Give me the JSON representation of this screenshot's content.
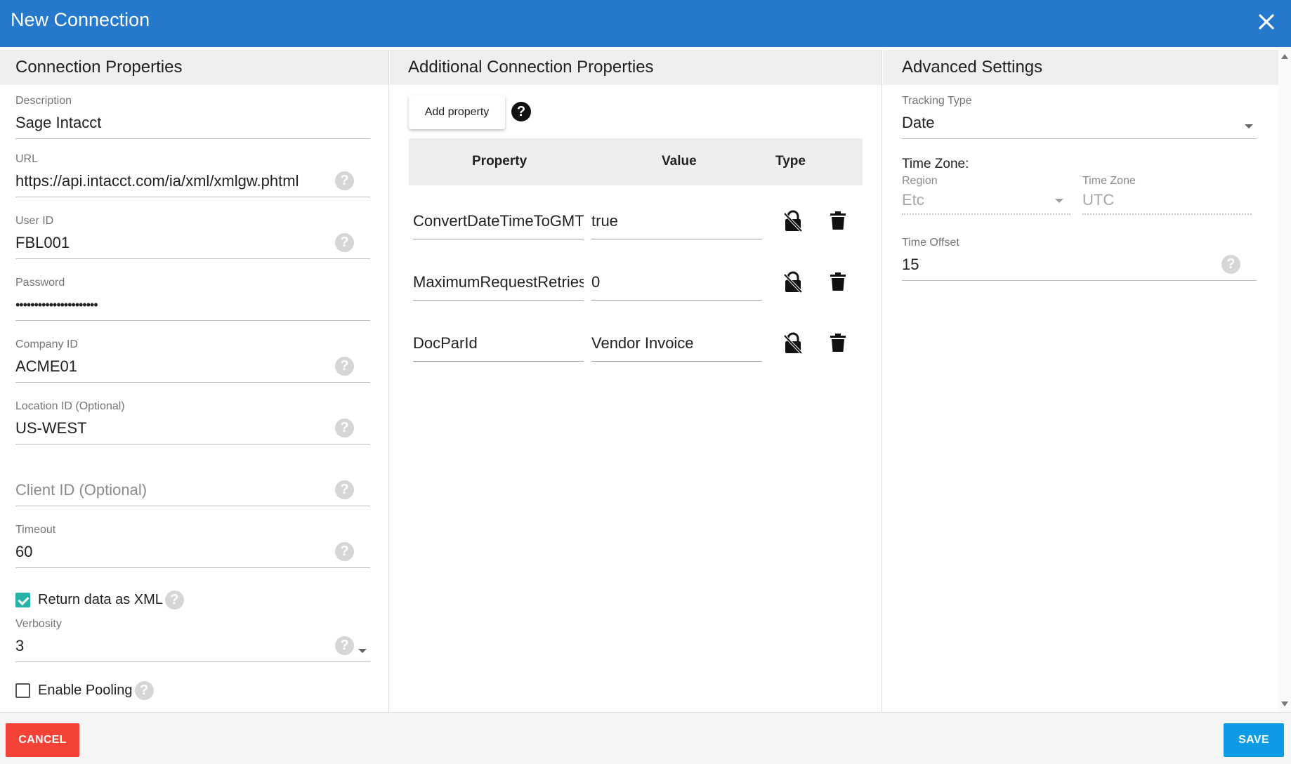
{
  "dialog": {
    "title": "New Connection"
  },
  "connection": {
    "heading": "Connection Properties",
    "description": {
      "label": "Description",
      "value": "Sage Intacct"
    },
    "url": {
      "label": "URL",
      "value": "https://api.intacct.com/ia/xml/xmlgw.phtml"
    },
    "user_id": {
      "label": "User ID",
      "value": "FBL001"
    },
    "password": {
      "label": "Password",
      "value": "••••••••••••••••••••••"
    },
    "company_id": {
      "label": "Company ID",
      "value": "ACME01"
    },
    "location_id": {
      "label": "Location ID (Optional)",
      "value": "US-WEST"
    },
    "client_id": {
      "placeholder": "Client ID (Optional)"
    },
    "timeout": {
      "label": "Timeout",
      "value": "60"
    },
    "return_xml": {
      "label": "Return data as XML",
      "checked": true
    },
    "verbosity": {
      "label": "Verbosity",
      "value": "3"
    },
    "enable_pooling": {
      "label": "Enable Pooling",
      "checked": false
    }
  },
  "additional": {
    "heading": "Additional Connection Properties",
    "add_button": "Add property",
    "columns": {
      "property": "Property",
      "value": "Value",
      "type": "Type"
    },
    "rows": [
      {
        "property": "ConvertDateTimeToGMT",
        "value": "true"
      },
      {
        "property": "MaximumRequestRetries",
        "value": "0"
      },
      {
        "property": "DocParId",
        "value": "Vendor Invoice"
      }
    ]
  },
  "advanced": {
    "heading": "Advanced Settings",
    "tracking_type": {
      "label": "Tracking Type",
      "value": "Date"
    },
    "time_zone_label": "Time Zone:",
    "region": {
      "label": "Region",
      "value": "Etc"
    },
    "time_zone": {
      "label": "Time Zone",
      "value": "UTC"
    },
    "time_offset": {
      "label": "Time Offset",
      "value": "15"
    }
  },
  "footer": {
    "cancel": "CANCEL",
    "save": "SAVE"
  },
  "colors": {
    "titlebar": "#2579cc",
    "cancel": "#f44336",
    "save": "#0e9be6",
    "checkbox": "#26b3a6"
  },
  "icons": {
    "close": "close-icon",
    "help": "help-icon",
    "lock": "lock-off-icon",
    "delete": "trash-icon",
    "dropdown": "chevron-down-icon"
  }
}
